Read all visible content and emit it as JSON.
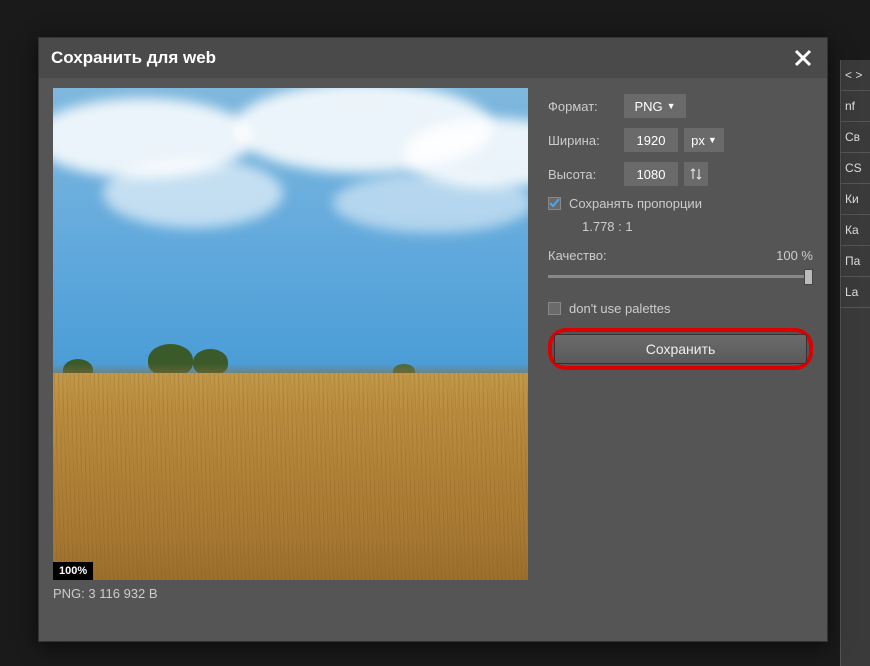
{
  "dialog": {
    "title": "Сохранить для web",
    "zoom": "100%",
    "file_info": "PNG: 3 116 932 B"
  },
  "panel": {
    "format_label": "Формат:",
    "format_value": "PNG",
    "width_label": "Ширина:",
    "width_value": "1920",
    "height_label": "Высота:",
    "height_value": "1080",
    "unit": "px",
    "keep_ratio_label": "Сохранять пропорции",
    "keep_ratio_checked": true,
    "ratio_text": "1.778 : 1",
    "quality_label": "Качество:",
    "quality_value": "100 %",
    "palette_label": "don't use palettes",
    "palette_checked": false,
    "save_label": "Сохранить"
  },
  "background_tabs": [
    "< >",
    "nf",
    "Св",
    "CS",
    "Ки",
    "Ка",
    "Па",
    "La"
  ]
}
